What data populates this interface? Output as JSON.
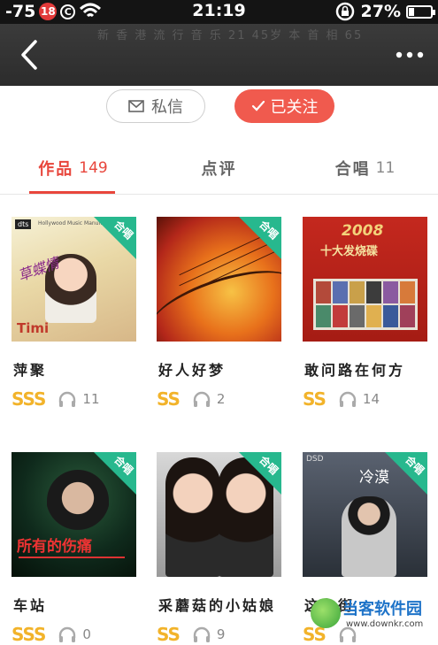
{
  "status_bar": {
    "signal": "-75",
    "badge": "18",
    "c_icon": "C",
    "time": "21:19",
    "battery": "27%",
    "battery_level": 0.27
  },
  "nav": {
    "subtitle": "新 香 港 流 行 音 乐 21 45岁 本 首 相 65"
  },
  "actions": {
    "message_label": "私信",
    "follow_label": "已关注"
  },
  "tabs": [
    {
      "label": "作品",
      "count": "149"
    },
    {
      "label": "点评",
      "count": ""
    },
    {
      "label": "合唱",
      "count": "11"
    }
  ],
  "corner_label": "合唱",
  "works": [
    {
      "title": "萍聚",
      "grade": "SSS",
      "plays": "11",
      "duet": true
    },
    {
      "title": "好人好梦",
      "grade": "SS",
      "plays": "2",
      "duet": true
    },
    {
      "title": "敢问路在何方",
      "grade": "SS",
      "plays": "14",
      "duet": false
    },
    {
      "title": "车站",
      "grade": "SSS",
      "plays": "0",
      "duet": true
    },
    {
      "title": "采蘑菇的小姑娘",
      "grade": "SS",
      "plays": "9",
      "duet": true
    },
    {
      "title": "这条街",
      "grade": "SS",
      "plays": "",
      "duet": true
    }
  ],
  "covers": [
    {
      "caption": "Hollywood Music Manufacturer",
      "sub": "Timi"
    },
    {
      "caption": "",
      "sub": ""
    },
    {
      "caption": "十大发烧碟",
      "sub": "2008"
    },
    {
      "caption": "所有的伤痛",
      "sub": ""
    },
    {
      "caption": "",
      "sub": ""
    },
    {
      "caption": "DSD",
      "sub": "冷漠"
    }
  ],
  "watermark": {
    "name": "当客软件园",
    "url": "www.downkr.com"
  }
}
